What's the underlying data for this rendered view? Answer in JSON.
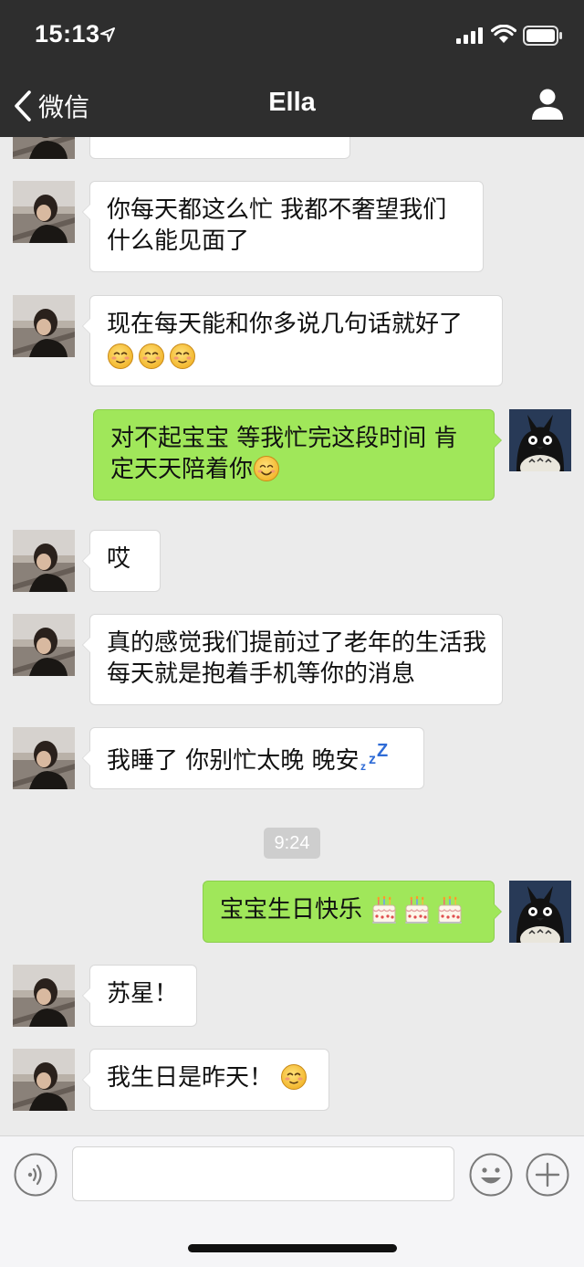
{
  "status_bar": {
    "time": "15:13"
  },
  "nav": {
    "back_label": "微信",
    "title": "Ella"
  },
  "messages": [
    {
      "side": "left",
      "text": ""
    },
    {
      "side": "left",
      "text": "你每天都这么忙 我都不奢望我们什么能见面了"
    },
    {
      "side": "left",
      "text": "现在每天能和你多说几句话就好了",
      "emojis": [
        "blush-emoji",
        "blush-emoji",
        "blush-emoji"
      ]
    },
    {
      "side": "right",
      "text": "对不起宝宝 等我忙完这段时间 肯定天天陪着你",
      "emojis": [
        "smile-emoji"
      ]
    },
    {
      "side": "left",
      "text": "哎"
    },
    {
      "side": "left",
      "text": "真的感觉我们提前过了老年的生活我每天就是抱着手机等你的消息"
    },
    {
      "side": "left",
      "text": "我睡了 你别忙太晚 晚安",
      "emojis": [
        "zzz-emoji"
      ]
    },
    {
      "side": "right",
      "text": "宝宝生日快乐",
      "emojis": [
        "cake-emoji",
        "cake-emoji",
        "cake-emoji"
      ]
    },
    {
      "side": "left",
      "text": "苏星！"
    },
    {
      "side": "left",
      "text": "我生日是昨天！",
      "emojis": [
        "blush-emoji"
      ]
    }
  ],
  "timestamp": "9:24",
  "input": {
    "placeholder": "",
    "value": ""
  },
  "icons": {
    "back": "chevron-left-icon",
    "profile": "person-icon",
    "voice": "voice-icon",
    "emoji": "smiley-icon",
    "more": "plus-icon"
  },
  "colors": {
    "nav_bg": "#2e2e2e",
    "chat_bg": "#ebebeb",
    "my_bubble": "#a0e75a",
    "their_bubble": "#ffffff"
  }
}
